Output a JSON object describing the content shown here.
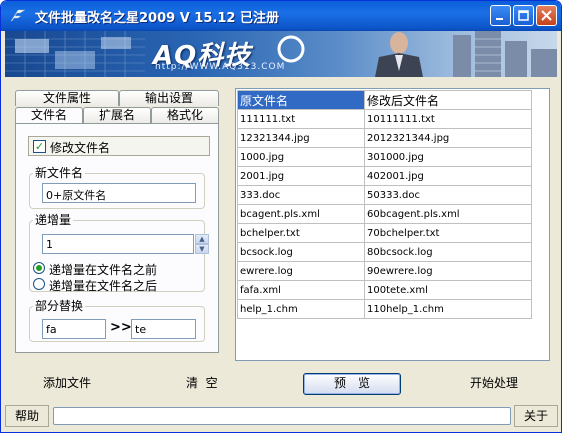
{
  "window": {
    "title": "文件批量改名之星2009 V 15.12  已注册",
    "minimize_icon": "minimize-icon",
    "maximize_icon": "maximize-icon",
    "close_icon": "close-icon"
  },
  "banner": {
    "brand": "AQ科技",
    "url": "http://WWW.AQ313.COM"
  },
  "tabs": {
    "row1": [
      "文件属性",
      "输出设置"
    ],
    "row2": [
      "文件名",
      "扩展名",
      "格式化"
    ],
    "active": "文件名"
  },
  "panel": {
    "modify_name_label": "修改文件名",
    "modify_name_checked": true,
    "new_name_title": "新文件名",
    "new_name_value": "0+原文件名",
    "increment_title": "递增量",
    "increment_value": "1",
    "radio_before": "递增量在文件名之前",
    "radio_after": "递增量在文件名之后",
    "radio_selected": "before",
    "replace_title": "部分替换",
    "replace_from": "fa",
    "replace_arrow": ">>",
    "replace_to": "te"
  },
  "table": {
    "headers": [
      "原文件名",
      "修改后文件名"
    ],
    "rows": [
      [
        "111111.txt",
        "10111111.txt"
      ],
      [
        "12321344.jpg",
        "2012321344.jpg"
      ],
      [
        "1000.jpg",
        "301000.jpg"
      ],
      [
        "2001.jpg",
        "402001.jpg"
      ],
      [
        "333.doc",
        "50333.doc"
      ],
      [
        "bcagent.pls.xml",
        "60bcagent.pls.xml"
      ],
      [
        "bchelper.txt",
        "70bchelper.txt"
      ],
      [
        "bcsock.log",
        "80bcsock.log"
      ],
      [
        "ewrere.log",
        "90ewrere.log"
      ],
      [
        "fafa.xml",
        "100tete.xml"
      ],
      [
        "help_1.chm",
        "110help_1.chm"
      ]
    ]
  },
  "actions": {
    "add_files": "添加文件",
    "clear": "清  空",
    "preview": "预览",
    "start": "开始处理"
  },
  "statusbar": {
    "help": "帮助",
    "about": "关于",
    "progress": 0
  },
  "colors": {
    "titlebar": "#0a5fd8",
    "selection": "#316ac5",
    "progress": "#2ab02a"
  }
}
